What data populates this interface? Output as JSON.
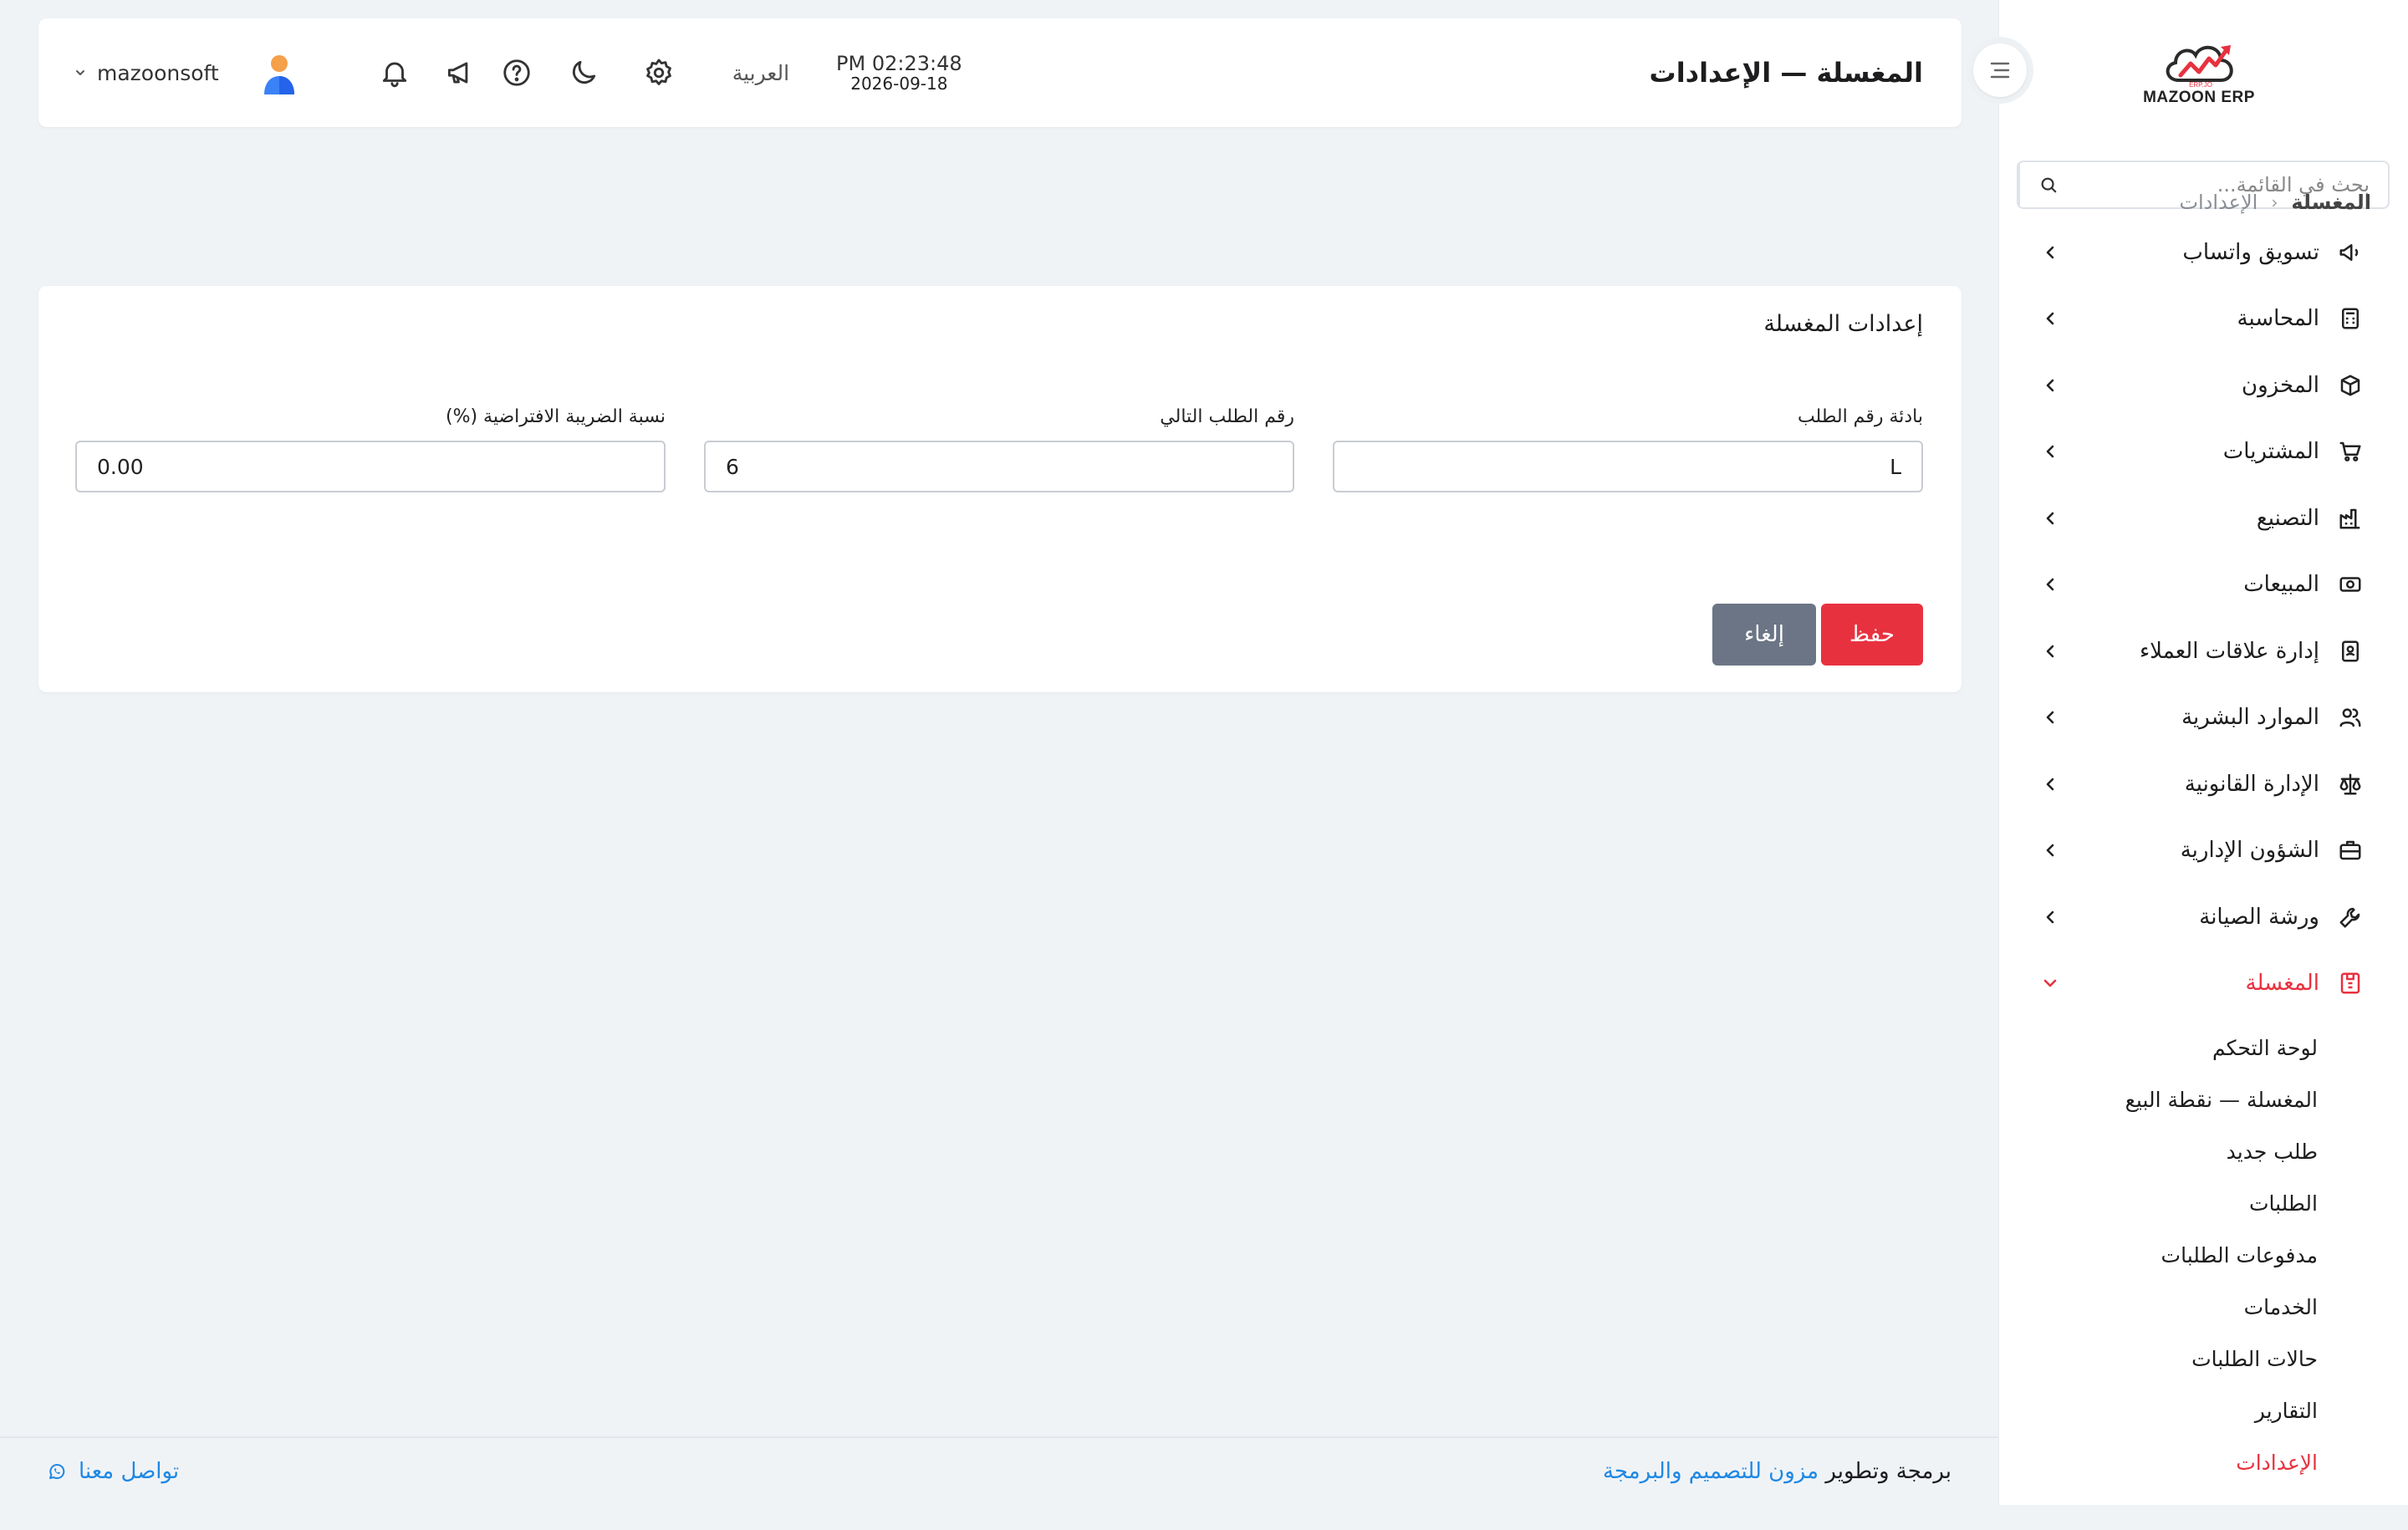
{
  "colors": {
    "accent": "#e8313f",
    "link": "#1e88e5",
    "cancel": "#6b7585"
  },
  "sidebar": {
    "logo_text": "MAZOON ERP",
    "search_placeholder": "بحث في القائمة...",
    "items": [
      {
        "label": "تسويق واتساب",
        "icon": "megaphone-icon"
      },
      {
        "label": "المحاسبة",
        "icon": "calculator-icon"
      },
      {
        "label": "المخزون",
        "icon": "box-icon"
      },
      {
        "label": "المشتريات",
        "icon": "cart-icon"
      },
      {
        "label": "التصنيع",
        "icon": "factory-icon"
      },
      {
        "label": "المبيعات",
        "icon": "cash-icon"
      },
      {
        "label": "إدارة علاقات العملاء",
        "icon": "contacts-icon"
      },
      {
        "label": "الموارد البشرية",
        "icon": "users-icon"
      },
      {
        "label": "الإدارة القانونية",
        "icon": "scale-icon"
      },
      {
        "label": "الشؤون الإدارية",
        "icon": "briefcase-icon"
      },
      {
        "label": "ورشة الصيانة",
        "icon": "wrench-icon"
      },
      {
        "label": "المغسلة",
        "icon": "washer-icon",
        "active": true
      }
    ],
    "submenu": [
      {
        "label": "لوحة التحكم"
      },
      {
        "label": "المغسلة — نقطة البيع"
      },
      {
        "label": "طلب جديد"
      },
      {
        "label": "الطلبات"
      },
      {
        "label": "مدفوعات الطلبات"
      },
      {
        "label": "الخدمات"
      },
      {
        "label": "حالات الطلبات"
      },
      {
        "label": "التقارير"
      },
      {
        "label": "الإعدادات",
        "active": true
      }
    ]
  },
  "header": {
    "title": "المغسلة — الإعدادات",
    "time": "PM 02:23:48",
    "date": "2026-09-18",
    "language": "العربية",
    "username": "mazoonsoft"
  },
  "breadcrumb": {
    "current": "المغسلة",
    "separator": "‹",
    "page": "الإعدادات"
  },
  "card": {
    "title": "إعدادات المغسلة",
    "fields": {
      "prefix": {
        "label": "بادئة رقم الطلب",
        "value": "L"
      },
      "next_number": {
        "label": "رقم الطلب التالي",
        "value": "6"
      },
      "tax_rate": {
        "label": "نسبة الضريبة الافتراضية (%)",
        "value": "0.00"
      }
    },
    "save_label": "حفظ",
    "cancel_label": "إلغاء"
  },
  "footer": {
    "credit_prefix": "برمجة وتطوير",
    "credit_link": "مزون للتصميم والبرمجة",
    "contact": "تواصل معنا"
  }
}
